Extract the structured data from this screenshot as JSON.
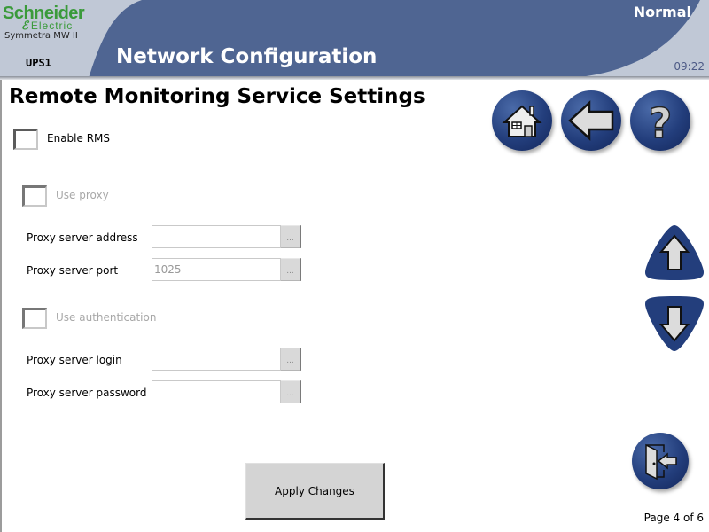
{
  "header": {
    "brand_line1": "Schneider",
    "brand_line2": "Electric",
    "product": "Symmetra MW II",
    "device": "UPS1",
    "title": "Network Configuration",
    "status": "Normal",
    "time": "09:22"
  },
  "nav": {
    "home_icon": "home-icon",
    "back_icon": "back-arrow-icon",
    "help_icon": "help-icon",
    "scroll_up_icon": "arrow-up-icon",
    "scroll_down_icon": "arrow-down-icon",
    "exit_icon": "logout-door-icon"
  },
  "main": {
    "section_title": "Remote Monitoring Service Settings",
    "enable_rms": {
      "label": "Enable RMS",
      "checked": false
    },
    "use_proxy": {
      "label": "Use proxy",
      "checked": false,
      "disabled": true
    },
    "proxy_address": {
      "label": "Proxy server address",
      "value": ""
    },
    "proxy_port": {
      "label": "Proxy server port",
      "value": "1025"
    },
    "use_auth": {
      "label": "Use authentication",
      "checked": false,
      "disabled": true
    },
    "proxy_login": {
      "label": "Proxy server login",
      "value": ""
    },
    "proxy_password": {
      "label": "Proxy server password",
      "value": ""
    },
    "browse_label": "...",
    "apply_label": "Apply Changes"
  },
  "footer": {
    "page_indicator": "Page 4 of 6"
  },
  "colors": {
    "header_blue": "#4f6592",
    "header_bg": "#c0c8d6",
    "brand_green": "#3a9a3a",
    "button_blue": "#233e7c"
  }
}
